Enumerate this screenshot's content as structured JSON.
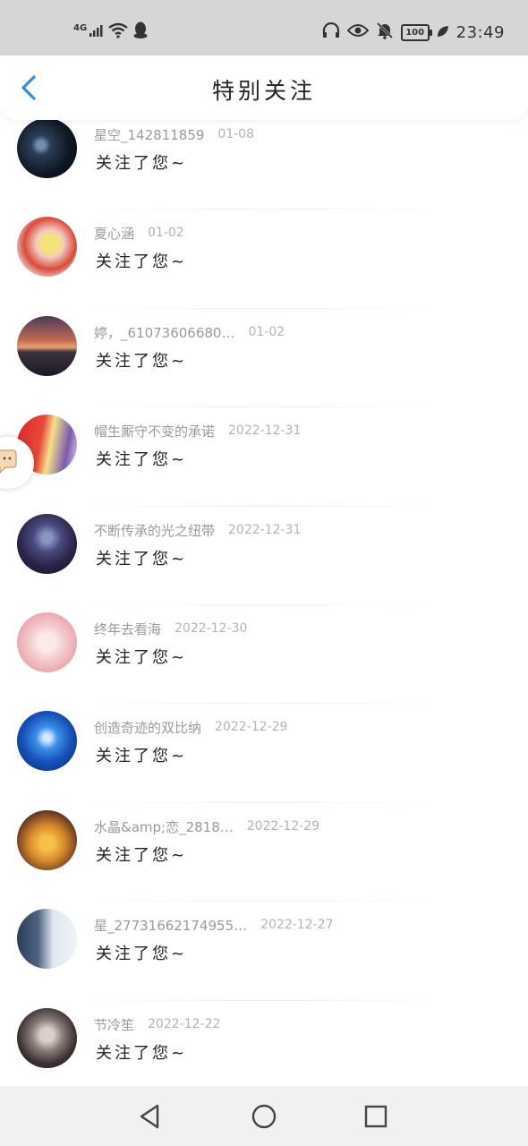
{
  "status_bar": {
    "network": "4G",
    "battery": "100",
    "time": "23:49"
  },
  "header": {
    "title": "特别关注"
  },
  "list": [
    {
      "name": "星空_142811859",
      "date": "01-08",
      "desc": "关注了您~"
    },
    {
      "name": "夏心涵",
      "date": "01-02",
      "desc": "关注了您~"
    },
    {
      "name": "婷，_61073606680…",
      "date": "01-02",
      "desc": "关注了您~"
    },
    {
      "name": "帽生厮守不变的承诺",
      "date": "2022-12-31",
      "desc": "关注了您~"
    },
    {
      "name": "不断传承的光之纽带",
      "date": "2022-12-31",
      "desc": "关注了您~"
    },
    {
      "name": "终年去看海",
      "date": "2022-12-30",
      "desc": "关注了您~"
    },
    {
      "name": "创造奇迹的双比纳",
      "date": "2022-12-29",
      "desc": "关注了您~"
    },
    {
      "name": "水晶&amp;恋_2818…",
      "date": "2022-12-29",
      "desc": "关注了您~"
    },
    {
      "name": "星_27731662174955…",
      "date": "2022-12-27",
      "desc": "关注了您~"
    },
    {
      "name": "节冷笙",
      "date": "2022-12-22",
      "desc": "关注了您~"
    }
  ],
  "colors": {
    "accent": "#2f8fe0",
    "status_bar_bg": "#d6d6d6",
    "nav_bg": "#f1f1f1"
  }
}
